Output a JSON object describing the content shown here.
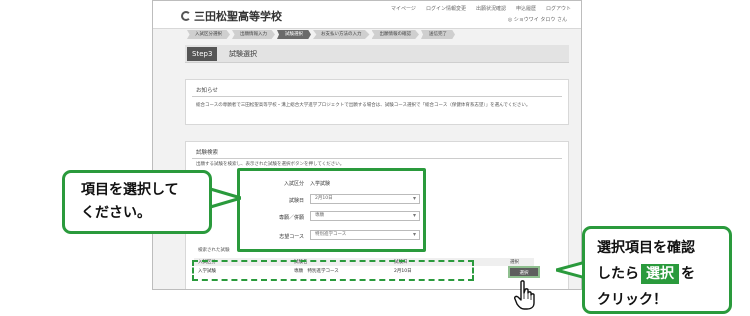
{
  "site": {
    "title": "三田松聖高等学校"
  },
  "header": {
    "links": [
      "マイページ",
      "ログイン情報変更",
      "出願状況確認",
      "申込履歴",
      "ログアウト"
    ],
    "user_text": "◎ ショウワイ タロウ さん"
  },
  "steps": [
    "入試区分選択",
    "出願情報入力",
    "試験選択",
    "お支払い方法の入力",
    "出願情報の確認",
    "送信完了"
  ],
  "step_header": {
    "badge": "Step3",
    "title": "試験選択"
  },
  "notice": {
    "heading": "お知らせ",
    "body": "総合コースの専願者で三田松聖高等学校・溝上総合大学進学プロジェクトで出願する場合は、試験コース選択で「総合コース（保健体育系志望）」を選んでください。"
  },
  "exam": {
    "heading": "試験検索",
    "instruction": "出願する試験を検索し、表示された試験を選択ボタンを押してください。",
    "fields": [
      {
        "label": "入試区分",
        "value": "入学試験"
      },
      {
        "label": "試験日",
        "value": "2月10日"
      },
      {
        "label": "専願／併願",
        "value": "専願"
      },
      {
        "label": "志望コース",
        "value": "特別進学コース"
      }
    ],
    "selected_title": "検索された試験",
    "table_headers": [
      "入試区分",
      "試験名",
      "試験日",
      "選択"
    ],
    "row": {
      "category": "入学試験",
      "name": "専願　特別進学コース",
      "date": "2月10日",
      "button": "選択"
    }
  },
  "annotations": {
    "left_callout": [
      "項目を選択して",
      "ください。"
    ],
    "right_callout": {
      "line1": "選択項目を確認",
      "line2_pre": "したら",
      "button": "選択",
      "line2_post": "を",
      "line3": "クリック！"
    }
  },
  "colors": {
    "accent": "#2a9a3c"
  }
}
